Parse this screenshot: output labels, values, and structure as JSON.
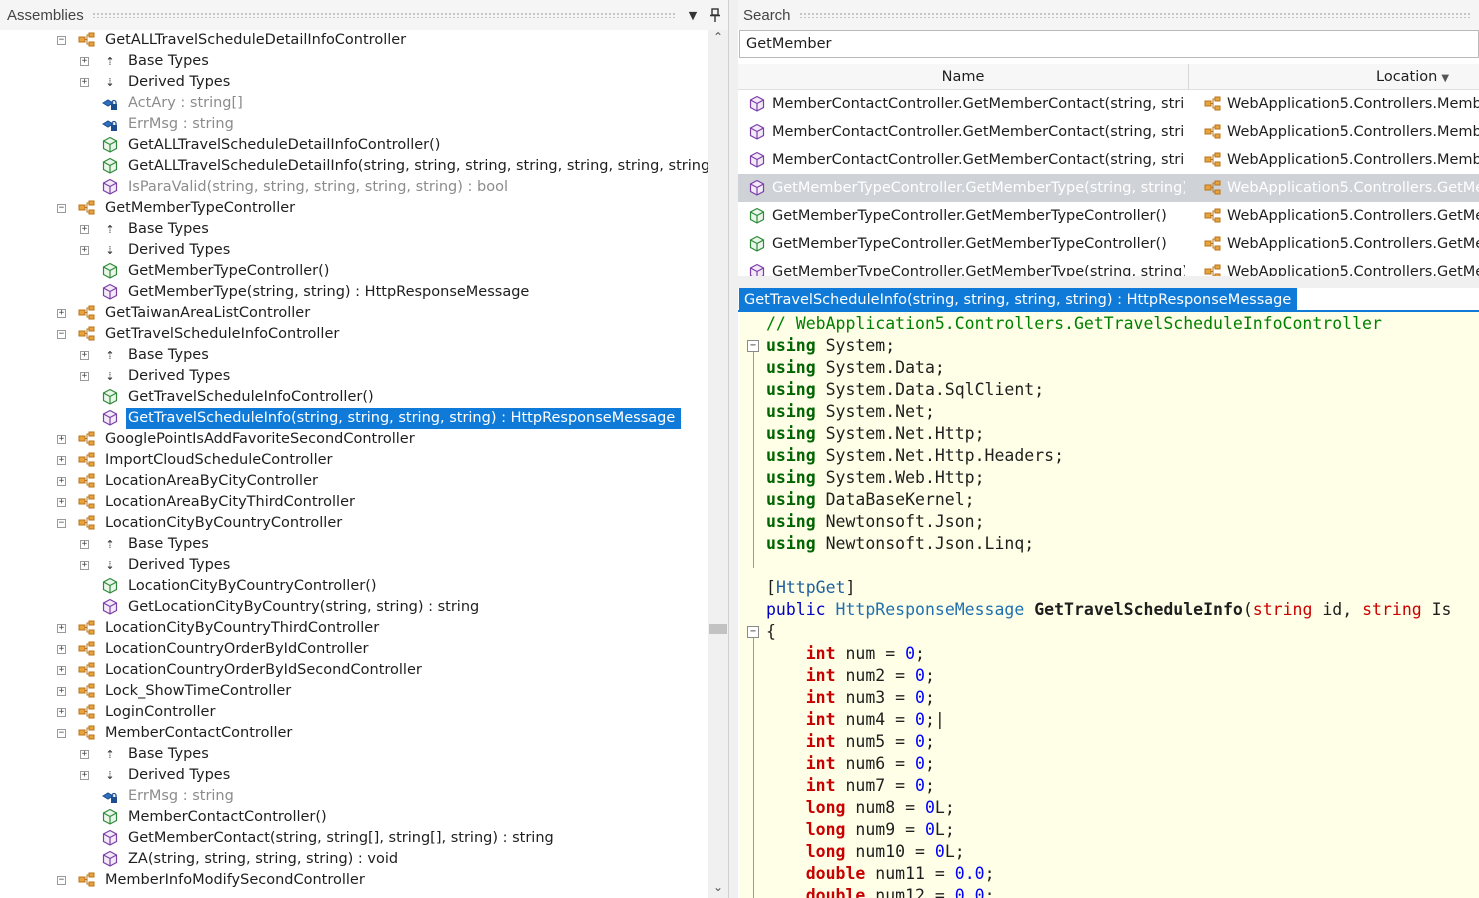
{
  "assemblies": {
    "title": "Assemblies",
    "tree": [
      {
        "level": 0,
        "kind": "class",
        "expanded": true,
        "label": "GetALLTravelScheduleDetailInfoController"
      },
      {
        "level": 1,
        "kind": "base",
        "label": "Base Types"
      },
      {
        "level": 1,
        "kind": "derived",
        "label": "Derived Types"
      },
      {
        "level": 1,
        "kind": "field",
        "gray": true,
        "label": "ActAry : string[]"
      },
      {
        "level": 1,
        "kind": "field",
        "gray": true,
        "label": "ErrMsg : string"
      },
      {
        "level": 1,
        "kind": "ctor",
        "label": "GetALLTravelScheduleDetailInfoController()"
      },
      {
        "level": 1,
        "kind": "ctor",
        "label": "GetALLTravelScheduleDetailInfo(string, string, string, string, string, string, string, str"
      },
      {
        "level": 1,
        "kind": "method-private",
        "gray": true,
        "label": "IsParaValid(string, string, string, string, string) : bool"
      },
      {
        "level": 0,
        "kind": "class",
        "expanded": true,
        "label": "GetMemberTypeController"
      },
      {
        "level": 1,
        "kind": "base",
        "label": "Base Types"
      },
      {
        "level": 1,
        "kind": "derived",
        "label": "Derived Types"
      },
      {
        "level": 1,
        "kind": "ctor",
        "label": "GetMemberTypeController()"
      },
      {
        "level": 1,
        "kind": "method",
        "label": "GetMemberType(string, string) : HttpResponseMessage"
      },
      {
        "level": 0,
        "kind": "class",
        "expanded": false,
        "label": "GetTaiwanAreaListController"
      },
      {
        "level": 0,
        "kind": "class",
        "expanded": true,
        "label": "GetTravelScheduleInfoController"
      },
      {
        "level": 1,
        "kind": "base",
        "label": "Base Types"
      },
      {
        "level": 1,
        "kind": "derived",
        "label": "Derived Types"
      },
      {
        "level": 1,
        "kind": "ctor",
        "label": "GetTravelScheduleInfoController()"
      },
      {
        "level": 1,
        "kind": "method",
        "selected": true,
        "label": "GetTravelScheduleInfo(string, string, string, string) : HttpResponseMessage"
      },
      {
        "level": 0,
        "kind": "class",
        "expanded": false,
        "label": "GooglePointIsAddFavoriteSecondController"
      },
      {
        "level": 0,
        "kind": "class",
        "expanded": false,
        "label": "ImportCloudScheduleController"
      },
      {
        "level": 0,
        "kind": "class",
        "expanded": false,
        "label": "LocationAreaByCityController"
      },
      {
        "level": 0,
        "kind": "class",
        "expanded": false,
        "label": "LocationAreaByCityThirdController"
      },
      {
        "level": 0,
        "kind": "class",
        "expanded": true,
        "label": "LocationCityByCountryController"
      },
      {
        "level": 1,
        "kind": "base",
        "label": "Base Types"
      },
      {
        "level": 1,
        "kind": "derived",
        "label": "Derived Types"
      },
      {
        "level": 1,
        "kind": "ctor",
        "label": "LocationCityByCountryController()"
      },
      {
        "level": 1,
        "kind": "method",
        "label": "GetLocationCityByCountry(string, string) : string"
      },
      {
        "level": 0,
        "kind": "class",
        "expanded": false,
        "label": "LocationCityByCountryThirdController"
      },
      {
        "level": 0,
        "kind": "class",
        "expanded": false,
        "label": "LocationCountryOrderByIdController"
      },
      {
        "level": 0,
        "kind": "class",
        "expanded": false,
        "label": "LocationCountryOrderByIdSecondController"
      },
      {
        "level": 0,
        "kind": "class",
        "expanded": false,
        "label": "Lock_ShowTimeController"
      },
      {
        "level": 0,
        "kind": "class",
        "expanded": false,
        "label": "LoginController"
      },
      {
        "level": 0,
        "kind": "class",
        "expanded": true,
        "label": "MemberContactController"
      },
      {
        "level": 1,
        "kind": "base",
        "label": "Base Types"
      },
      {
        "level": 1,
        "kind": "derived",
        "label": "Derived Types"
      },
      {
        "level": 1,
        "kind": "field",
        "gray": true,
        "label": "ErrMsg : string"
      },
      {
        "level": 1,
        "kind": "ctor",
        "label": "MemberContactController()"
      },
      {
        "level": 1,
        "kind": "method",
        "label": "GetMemberContact(string, string[], string[], string) : string"
      },
      {
        "level": 1,
        "kind": "method-private",
        "label": "ZA(string, string, string, string) : void"
      },
      {
        "level": 0,
        "kind": "class",
        "expanded": true,
        "label": "MemberInfoModifySecondController"
      }
    ]
  },
  "search": {
    "title": "Search",
    "query": "GetMember",
    "col_name": "Name",
    "col_location": "Location",
    "results": [
      {
        "kind": "method",
        "name": "MemberContactController.GetMemberContact(string, string",
        "location": "WebApplication5.Controllers.Membe"
      },
      {
        "kind": "method",
        "name": "MemberContactController.GetMemberContact(string, string",
        "location": "WebApplication5.Controllers.Membe"
      },
      {
        "kind": "method",
        "name": "MemberContactController.GetMemberContact(string, string",
        "location": "WebApplication5.Controllers.Membe"
      },
      {
        "kind": "method",
        "highlight": true,
        "name": "GetMemberTypeController.GetMemberType(string, string) :",
        "location": "WebApplication5.Controllers.GetMem"
      },
      {
        "kind": "ctor",
        "name": "GetMemberTypeController.GetMemberTypeController()",
        "location": "WebApplication5.Controllers.GetMen"
      },
      {
        "kind": "ctor",
        "name": "GetMemberTypeController.GetMemberTypeController()",
        "location": "WebApplication5.Controllers.GetMen"
      },
      {
        "kind": "method",
        "name": "GetMemberTypeController.GetMemberType(string, string) :",
        "location": "WebApplication5.Controllers.GetMen"
      }
    ]
  },
  "document": {
    "tab_title": "GetTravelScheduleInfo(string, string, string, string) : HttpResponseMessage",
    "lines": [
      [
        {
          "c": "cm",
          "t": "// WebApplication5.Controllers.GetTravelScheduleInfoController"
        }
      ],
      [
        {
          "c": "kw-g",
          "t": "using"
        },
        {
          "c": "",
          "t": " System;"
        }
      ],
      [
        {
          "c": "kw-g",
          "t": "using"
        },
        {
          "c": "",
          "t": " System.Data;"
        }
      ],
      [
        {
          "c": "kw-g",
          "t": "using"
        },
        {
          "c": "",
          "t": " System.Data.SqlClient;"
        }
      ],
      [
        {
          "c": "kw-g",
          "t": "using"
        },
        {
          "c": "",
          "t": " System.Net;"
        }
      ],
      [
        {
          "c": "kw-g",
          "t": "using"
        },
        {
          "c": "",
          "t": " System.Net.Http;"
        }
      ],
      [
        {
          "c": "kw-g",
          "t": "using"
        },
        {
          "c": "",
          "t": " System.Net.Http.Headers;"
        }
      ],
      [
        {
          "c": "kw-g",
          "t": "using"
        },
        {
          "c": "",
          "t": " System.Web.Http;"
        }
      ],
      [
        {
          "c": "kw-g",
          "t": "using"
        },
        {
          "c": "",
          "t": " DataBaseKernel;"
        }
      ],
      [
        {
          "c": "kw-g",
          "t": "using"
        },
        {
          "c": "",
          "t": " Newtonsoft.Json;"
        }
      ],
      [
        {
          "c": "kw-g",
          "t": "using"
        },
        {
          "c": "",
          "t": " Newtonsoft.Json.Linq;"
        }
      ],
      [],
      [
        {
          "c": "",
          "t": "["
        },
        {
          "c": "attr",
          "t": "HttpGet"
        },
        {
          "c": "",
          "t": "]"
        }
      ],
      [
        {
          "c": "kw-b",
          "t": "public"
        },
        {
          "c": "",
          "t": " "
        },
        {
          "c": "typ",
          "t": "HttpResponseMessage"
        },
        {
          "c": "",
          "t": " "
        },
        {
          "c": "fn",
          "t": "GetTravelScheduleInfo"
        },
        {
          "c": "",
          "t": "("
        },
        {
          "c": "kw-r2",
          "t": "string"
        },
        {
          "c": "",
          "t": " id, "
        },
        {
          "c": "kw-r2",
          "t": "string"
        },
        {
          "c": "",
          "t": " Is"
        }
      ],
      [
        {
          "c": "",
          "t": "{"
        }
      ],
      [
        {
          "c": "",
          "t": "    "
        },
        {
          "c": "kw-r",
          "t": "int"
        },
        {
          "c": "",
          "t": " num = "
        },
        {
          "c": "num",
          "t": "0"
        },
        {
          "c": "",
          "t": ";"
        }
      ],
      [
        {
          "c": "",
          "t": "    "
        },
        {
          "c": "kw-r",
          "t": "int"
        },
        {
          "c": "",
          "t": " num2 = "
        },
        {
          "c": "num",
          "t": "0"
        },
        {
          "c": "",
          "t": ";"
        }
      ],
      [
        {
          "c": "",
          "t": "    "
        },
        {
          "c": "kw-r",
          "t": "int"
        },
        {
          "c": "",
          "t": " num3 = "
        },
        {
          "c": "num",
          "t": "0"
        },
        {
          "c": "",
          "t": ";"
        }
      ],
      [
        {
          "c": "",
          "t": "    "
        },
        {
          "c": "kw-r",
          "t": "int"
        },
        {
          "c": "",
          "t": " num4 = "
        },
        {
          "c": "num",
          "t": "0"
        },
        {
          "c": "",
          "t": ";|"
        }
      ],
      [
        {
          "c": "",
          "t": "    "
        },
        {
          "c": "kw-r",
          "t": "int"
        },
        {
          "c": "",
          "t": " num5 = "
        },
        {
          "c": "num",
          "t": "0"
        },
        {
          "c": "",
          "t": ";"
        }
      ],
      [
        {
          "c": "",
          "t": "    "
        },
        {
          "c": "kw-r",
          "t": "int"
        },
        {
          "c": "",
          "t": " num6 = "
        },
        {
          "c": "num",
          "t": "0"
        },
        {
          "c": "",
          "t": ";"
        }
      ],
      [
        {
          "c": "",
          "t": "    "
        },
        {
          "c": "kw-r",
          "t": "int"
        },
        {
          "c": "",
          "t": " num7 = "
        },
        {
          "c": "num",
          "t": "0"
        },
        {
          "c": "",
          "t": ";"
        }
      ],
      [
        {
          "c": "",
          "t": "    "
        },
        {
          "c": "kw-r",
          "t": "long"
        },
        {
          "c": "",
          "t": " num8 = "
        },
        {
          "c": "num",
          "t": "0"
        },
        {
          "c": "",
          "t": "L;"
        }
      ],
      [
        {
          "c": "",
          "t": "    "
        },
        {
          "c": "kw-r",
          "t": "long"
        },
        {
          "c": "",
          "t": " num9 = "
        },
        {
          "c": "num",
          "t": "0"
        },
        {
          "c": "",
          "t": "L;"
        }
      ],
      [
        {
          "c": "",
          "t": "    "
        },
        {
          "c": "kw-r",
          "t": "long"
        },
        {
          "c": "",
          "t": " num10 = "
        },
        {
          "c": "num",
          "t": "0"
        },
        {
          "c": "",
          "t": "L;"
        }
      ],
      [
        {
          "c": "",
          "t": "    "
        },
        {
          "c": "kw-r",
          "t": "double"
        },
        {
          "c": "",
          "t": " num11 = "
        },
        {
          "c": "num",
          "t": "0.0"
        },
        {
          "c": "",
          "t": ";"
        }
      ],
      [
        {
          "c": "",
          "t": "    "
        },
        {
          "c": "kw-r",
          "t": "double"
        },
        {
          "c": "",
          "t": " num12 = "
        },
        {
          "c": "num",
          "t": "0.0"
        },
        {
          "c": "",
          "t": ";"
        }
      ]
    ]
  },
  "colors": {
    "selection": "#0f7ad8",
    "code_background": "#ffffe7",
    "comment": "#008000",
    "keyword_red": "#c80000",
    "keyword_green": "#006400"
  }
}
